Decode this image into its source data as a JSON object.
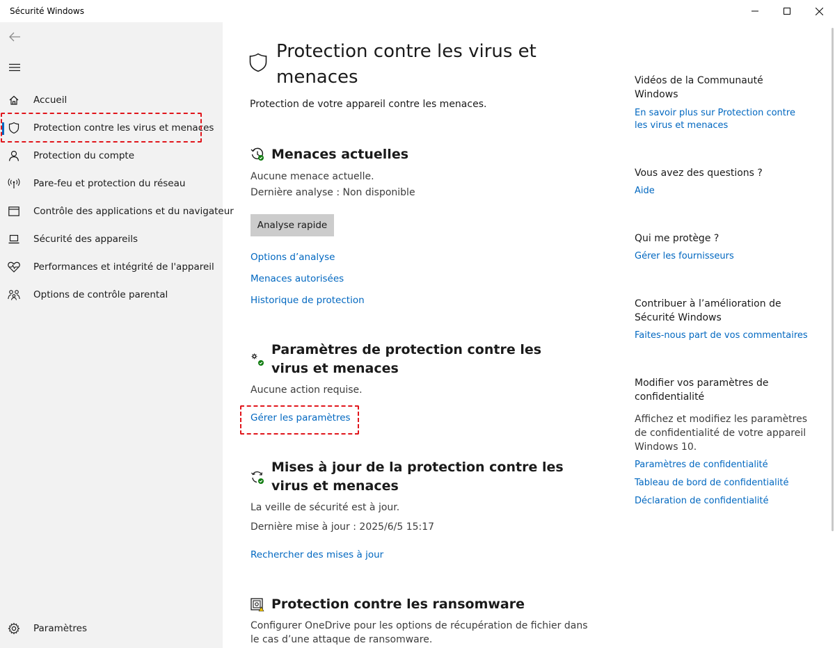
{
  "window": {
    "title": "Sécurité Windows"
  },
  "sidebar": {
    "items": [
      {
        "label": "Accueil",
        "icon": "home-icon"
      },
      {
        "label": "Protection contre les virus et menaces",
        "icon": "shield-icon",
        "selected": true
      },
      {
        "label": "Protection du compte",
        "icon": "person-icon"
      },
      {
        "label": "Pare-feu et protection du réseau",
        "icon": "wifi-antenna-icon"
      },
      {
        "label": "Contrôle des applications et du navigateur",
        "icon": "app-browser-icon"
      },
      {
        "label": "Sécurité des appareils",
        "icon": "laptop-icon"
      },
      {
        "label": "Performances et intégrité de l'appareil",
        "icon": "heart-pulse-icon"
      },
      {
        "label": "Options de contrôle parental",
        "icon": "family-icon"
      }
    ],
    "settings_label": "Paramètres"
  },
  "main": {
    "title": "Protection contre les virus et menaces",
    "subtitle": "Protection de votre appareil contre les menaces.",
    "current_threats": {
      "title": "Menaces actuelles",
      "line1": "Aucune menace actuelle.",
      "line2": "Dernière analyse : Non disponible",
      "button": "Analyse rapide",
      "links": [
        "Options d’analyse",
        "Menaces autorisées",
        "Historique de protection"
      ]
    },
    "settings": {
      "title": "Paramètres de protection contre les virus et menaces",
      "status": "Aucune action requise.",
      "link": "Gérer les paramètres"
    },
    "updates": {
      "title": "Mises à jour de la protection contre les virus et menaces",
      "line1": "La veille de sécurité est à jour.",
      "line2": "Dernière mise à jour : 2025/6/5 15:17",
      "link": "Rechercher des mises à jour"
    },
    "ransomware": {
      "title": "Protection contre les ransomware",
      "text": "Configurer OneDrive pour les options de récupération de fichier dans le cas d’une attaque de ransomware."
    }
  },
  "aside": {
    "videos": {
      "title": "Vidéos de la Communauté Windows",
      "link": "En savoir plus sur Protection contre les virus et menaces"
    },
    "questions": {
      "title": "Vous avez des questions ?",
      "link": "Aide"
    },
    "protector": {
      "title": "Qui me protège ?",
      "link": "Gérer les fournisseurs"
    },
    "contribute": {
      "title": "Contribuer à l’amélioration de Sécurité Windows",
      "link": "Faites-nous part de vos commentaires"
    },
    "privacy": {
      "title": "Modifier vos paramètres de confidentialité",
      "text": "Affichez et modifiez les paramètres de confidentialité de votre appareil Windows 10.",
      "links": [
        "Paramètres de confidentialité",
        "Tableau de bord de confidentialité",
        "Déclaration de confidentialité"
      ]
    }
  },
  "colors": {
    "accent": "#0067c0",
    "highlight": "#e0151b",
    "sidebar_bg": "#f2f2f2",
    "button_bg": "#cccccc",
    "ok_green": "#107c10"
  }
}
